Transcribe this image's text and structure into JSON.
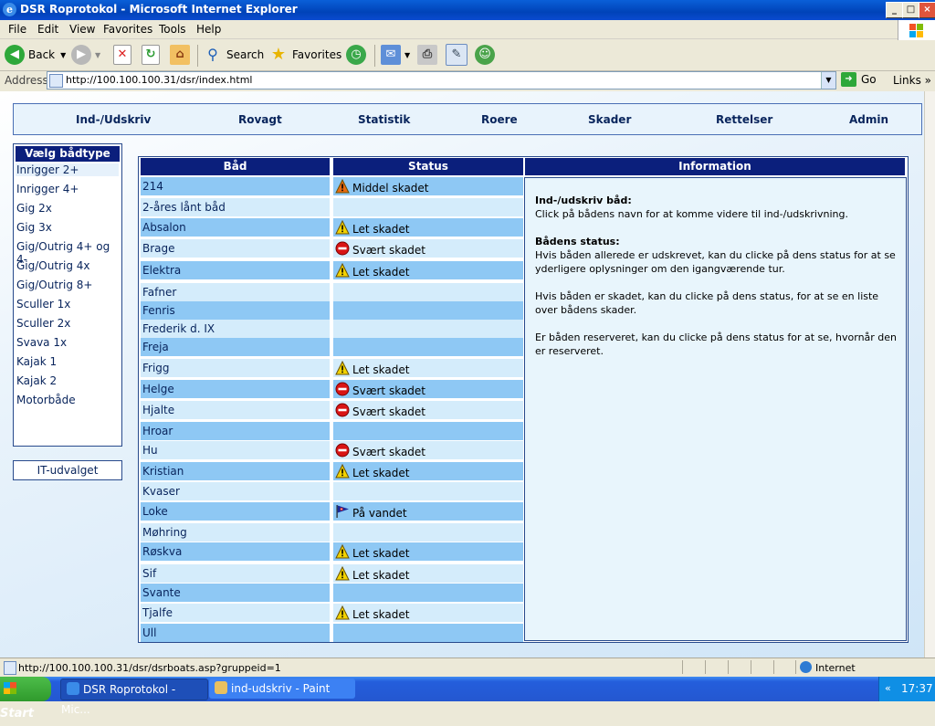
{
  "window": {
    "title": "DSR Roprotokol - Microsoft Internet Explorer"
  },
  "menu": [
    "File",
    "Edit",
    "View",
    "Favorites",
    "Tools",
    "Help"
  ],
  "toolbar": {
    "back": "Back",
    "search": "Search",
    "favorites": "Favorites"
  },
  "address": {
    "label": "Address",
    "url": "http://100.100.100.31/dsr/index.html",
    "go": "Go",
    "links": "Links"
  },
  "nav": [
    "Ind-/Udskriv",
    "Rovagt",
    "Statistik",
    "Roere",
    "Skader",
    "Rettelser",
    "Admin"
  ],
  "sidebar": {
    "title": "Vælg bådtype",
    "items": [
      "Inrigger 2+",
      "Inrigger 4+",
      "Gig 2x",
      "Gig 3x",
      "Gig/Outrig 4+ og 4-",
      "Gig/Outrig 4x",
      "Gig/Outrig 8+",
      "Sculler 1x",
      "Sculler 2x",
      "Svava 1x",
      "Kajak 1",
      "Kajak 2",
      "Motorbåde"
    ],
    "footer": "IT-udvalget"
  },
  "table": {
    "headers": [
      "Båd",
      "Status",
      "Information"
    ],
    "rows": [
      {
        "name": "214",
        "status": "Middel skadet",
        "icon": "warning-orange-icon"
      },
      {
        "name": "2-åres lånt båd",
        "status": "",
        "icon": ""
      },
      {
        "name": "Absalon",
        "status": "Let skadet",
        "icon": "warning-icon"
      },
      {
        "name": "Brage",
        "status": "Svært skadet",
        "icon": "stop-icon"
      },
      {
        "name": "Elektra",
        "status": "Let skadet",
        "icon": "warning-icon"
      },
      {
        "name": "Fafner",
        "status": "",
        "icon": ""
      },
      {
        "name": "Fenris",
        "status": "",
        "icon": ""
      },
      {
        "name": "Frederik d. IX",
        "status": "",
        "icon": ""
      },
      {
        "name": "Freja",
        "status": "",
        "icon": ""
      },
      {
        "name": "Frigg",
        "status": "Let skadet",
        "icon": "warning-icon"
      },
      {
        "name": "Helge",
        "status": "Svært skadet",
        "icon": "stop-icon"
      },
      {
        "name": "Hjalte",
        "status": "Svært skadet",
        "icon": "stop-icon"
      },
      {
        "name": "Hroar",
        "status": "",
        "icon": ""
      },
      {
        "name": "Hu",
        "status": "Svært skadet",
        "icon": "stop-icon"
      },
      {
        "name": "Kristian",
        "status": "Let skadet",
        "icon": "warning-icon"
      },
      {
        "name": "Kvaser",
        "status": "",
        "icon": ""
      },
      {
        "name": "Loke",
        "status": "På vandet",
        "icon": "flag-icon"
      },
      {
        "name": "Møhring",
        "status": "",
        "icon": ""
      },
      {
        "name": "Røskva",
        "status": "Let skadet",
        "icon": "warning-icon"
      },
      {
        "name": "Sif",
        "status": "Let skadet",
        "icon": "warning-icon"
      },
      {
        "name": "Svante",
        "status": "",
        "icon": ""
      },
      {
        "name": "Tjalfe",
        "status": "Let skadet",
        "icon": "warning-icon"
      },
      {
        "name": "Ull",
        "status": "",
        "icon": ""
      }
    ]
  },
  "info": {
    "h1": "Ind-/udskriv båd:",
    "p1": "Click på bådens navn for at komme videre til ind-/udskrivning.",
    "h2": "Bådens status:",
    "p2": "Hvis båden allerede er udskrevet, kan du clicke på dens status for at se yderligere oplysninger om den igangværende tur.",
    "p3": "Hvis båden er skadet, kan du clicke på dens status, for at se en liste over bådens skader.",
    "p4": "Er båden reserveret, kan du clicke på dens status for at se, hvornår den er reserveret."
  },
  "statusbar": {
    "url": "http://100.100.100.31/dsr/dsrboats.asp?gruppeid=1",
    "zone": "Internet"
  },
  "taskbar": {
    "start": "Start",
    "task1": "DSR Roprotokol - Mic...",
    "task2": "ind-udskriv - Paint",
    "time": "17:37"
  }
}
